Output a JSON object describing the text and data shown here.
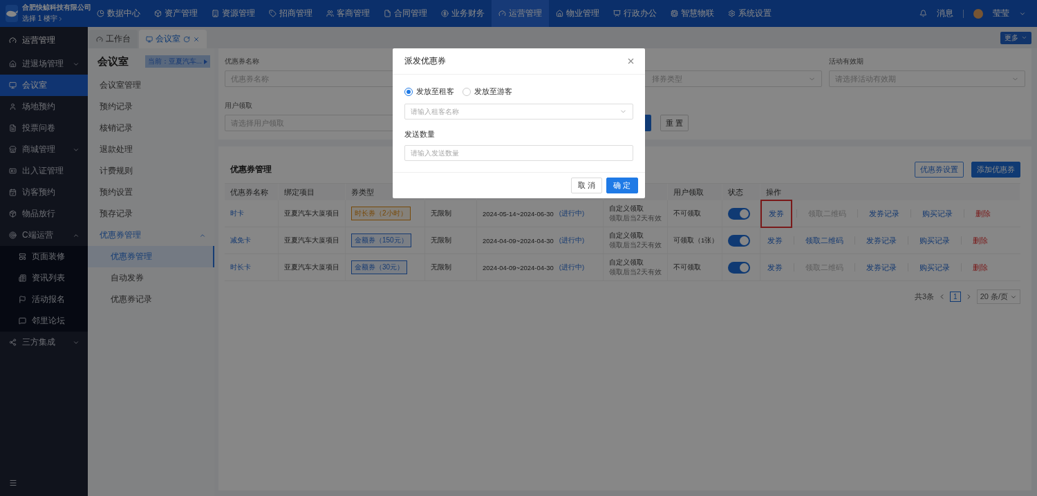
{
  "header": {
    "company": "合肥快鲸科技有限公司",
    "building": "选择 1 楼宇",
    "nav": [
      {
        "label": "数据中心",
        "selected": false
      },
      {
        "label": "资产管理",
        "selected": false
      },
      {
        "label": "资源管理",
        "selected": false
      },
      {
        "label": "招商管理",
        "selected": false
      },
      {
        "label": "客商管理",
        "selected": false
      },
      {
        "label": "合同管理",
        "selected": false
      },
      {
        "label": "业务财务",
        "selected": false
      },
      {
        "label": "运营管理",
        "selected": true
      },
      {
        "label": "物业管理",
        "selected": false
      },
      {
        "label": "行政办公",
        "selected": false
      },
      {
        "label": "智慧物联",
        "selected": false
      },
      {
        "label": "系统设置",
        "selected": false
      }
    ],
    "messages": "消息",
    "user": "莹莹"
  },
  "sidebar": {
    "title": "运营管理",
    "items": [
      {
        "label": "进退场管理",
        "selected": false,
        "expanded": false
      },
      {
        "label": "会议室",
        "selected": true
      },
      {
        "label": "场地预约",
        "selected": false
      },
      {
        "label": "投票问卷",
        "selected": false
      },
      {
        "label": "商城管理",
        "selected": false,
        "expanded": false
      },
      {
        "label": "出入证管理",
        "selected": false
      },
      {
        "label": "访客预约",
        "selected": false
      },
      {
        "label": "物品放行",
        "selected": false
      },
      {
        "label": "C端运营",
        "selected": false,
        "expanded": true,
        "children": [
          {
            "label": "页面装修",
            "selected": false
          },
          {
            "label": "资讯列表",
            "selected": false
          },
          {
            "label": "活动报名",
            "selected": false
          },
          {
            "label": "邻里论坛",
            "selected": false
          }
        ]
      },
      {
        "label": "三方集成",
        "selected": false,
        "expanded": false
      }
    ]
  },
  "tabs": [
    {
      "label": "工作台",
      "selected": false
    },
    {
      "label": "会议室",
      "selected": true
    }
  ],
  "more_button": "更多",
  "submenu": {
    "title": "会议室",
    "current": "当前：亚夏汽车...",
    "items": [
      {
        "label": "会议室管理",
        "selected": false
      },
      {
        "label": "预约记录",
        "selected": false
      },
      {
        "label": "核销记录",
        "selected": false
      },
      {
        "label": "退款处理",
        "selected": false
      },
      {
        "label": "计费规则",
        "selected": false
      },
      {
        "label": "预约设置",
        "selected": false
      },
      {
        "label": "预存记录",
        "selected": false
      },
      {
        "label": "优惠券管理",
        "selected": false,
        "expanded": true,
        "children": [
          {
            "label": "优惠券管理",
            "selected": true
          },
          {
            "label": "自动发券",
            "selected": false
          },
          {
            "label": "优惠券记录",
            "selected": false
          }
        ]
      }
    ]
  },
  "filters": {
    "name_label": "优惠券名称",
    "name_placeholder": "优惠券名称",
    "type_placeholder": "择券类型",
    "period_label": "活动有效期",
    "period_placeholder": "请选择活动有效期",
    "claim_label": "用户领取",
    "claim_placeholder": "请选择用户领取",
    "reset": "重 置"
  },
  "coupons": {
    "title": "优惠券管理",
    "buttons": [
      "优惠券设置",
      "添加优惠券"
    ],
    "columns": [
      "优惠券名称",
      "绑定项目",
      "券类型",
      "用户领取",
      "状态",
      "操作"
    ],
    "rows": [
      {
        "name": "时卡",
        "project": "亚夏汽车大厦项目",
        "type": {
          "label": "时长券（2小时）",
          "kind": "duration"
        },
        "limit": "无限制",
        "period": "2024-05-14~2024-06-30",
        "period_status": "(进行中)",
        "claim_method": "自定义领取",
        "claim_note": "领取后当2天有效",
        "user_claim": "不可领取",
        "on": true,
        "actions": [
          {
            "label": "发券",
            "disabled": false,
            "danger": false,
            "highlighted": true
          },
          {
            "label": "领取二维码",
            "disabled": true,
            "danger": false,
            "highlighted": false
          },
          {
            "label": "发券记录",
            "disabled": false,
            "danger": false,
            "highlighted": false
          },
          {
            "label": "购买记录",
            "disabled": false,
            "danger": false,
            "highlighted": false
          },
          {
            "label": "删除",
            "disabled": false,
            "danger": true,
            "highlighted": false
          }
        ]
      },
      {
        "name": "减免卡",
        "project": "亚夏汽车大厦项目",
        "type": {
          "label": "金额券（150元）",
          "kind": "amount"
        },
        "limit": "无限制",
        "period": "2024-04-09~2024-04-30",
        "period_status": "(进行中)",
        "claim_method": "自定义领取",
        "claim_note": "领取后当2天有效",
        "user_claim": "可领取（1张）",
        "on": true,
        "actions": [
          {
            "label": "发券",
            "disabled": false,
            "danger": false,
            "highlighted": false
          },
          {
            "label": "领取二维码",
            "disabled": false,
            "danger": false,
            "highlighted": false
          },
          {
            "label": "发券记录",
            "disabled": false,
            "danger": false,
            "highlighted": false
          },
          {
            "label": "购买记录",
            "disabled": false,
            "danger": false,
            "highlighted": false
          },
          {
            "label": "删除",
            "disabled": false,
            "danger": true,
            "highlighted": false
          }
        ]
      },
      {
        "name": "时长卡",
        "project": "亚夏汽车大厦项目",
        "type": {
          "label": "金额券（30元）",
          "kind": "amount"
        },
        "limit": "无限制",
        "period": "2024-04-09~2024-04-30",
        "period_status": "(进行中)",
        "claim_method": "自定义领取",
        "claim_note": "领取后当2天有效",
        "user_claim": "不可领取",
        "on": true,
        "actions": [
          {
            "label": "发券",
            "disabled": false,
            "danger": false,
            "highlighted": false
          },
          {
            "label": "领取二维码",
            "disabled": true,
            "danger": false,
            "highlighted": false
          },
          {
            "label": "发券记录",
            "disabled": false,
            "danger": false,
            "highlighted": false
          },
          {
            "label": "购买记录",
            "disabled": false,
            "danger": false,
            "highlighted": false
          },
          {
            "label": "删除",
            "disabled": false,
            "danger": true,
            "highlighted": false
          }
        ]
      }
    ],
    "total": "共3条",
    "page": "1",
    "page_size": "20 条/页"
  },
  "dialog": {
    "title": "派发优惠券",
    "options": [
      {
        "label": "发放至租客",
        "selected": true
      },
      {
        "label": "发放至游客",
        "selected": false
      }
    ],
    "tenant_placeholder": "请输入租客名称",
    "quantity_label": "发送数量",
    "quantity_placeholder": "请输入发送数量",
    "cancel": "取 消",
    "ok": "确 定"
  }
}
